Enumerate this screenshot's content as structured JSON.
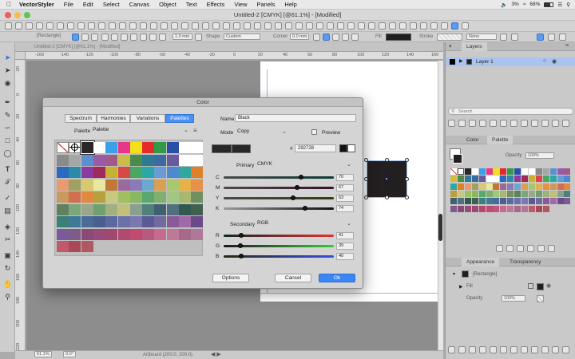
{
  "menubar": {
    "apple": "",
    "app": "VectorStyler",
    "items": [
      "File",
      "Edit",
      "Select",
      "Canvas",
      "Object",
      "Text",
      "Effects",
      "View",
      "Panels",
      "Help"
    ],
    "status": {
      "battery": "68%",
      "volume": "3%",
      "time": "Q"
    }
  },
  "window": {
    "title": "Untitled-2 [CMYK] [@61.1%] - [Modified]",
    "doc_tab": "Untitled-2 [CMYK] [@61.1%] - [Modified]"
  },
  "toolbar": {
    "object_type": "[Rectangle]",
    "stroke_width": "1.0 mm",
    "shape_label": "Shape",
    "shape_value": "Custom",
    "corner_label": "Corner",
    "corner_value": "0.0 mm",
    "fill_label": "Fill",
    "stroke_label": "Stroke",
    "stroke_value": "None"
  },
  "rulers": {
    "h_ticks": [
      "-160",
      "-140",
      "-120",
      "-100",
      "-80",
      "-60",
      "-40",
      "-20",
      "0",
      "20",
      "40",
      "60",
      "80",
      "100",
      "120",
      "140",
      "160"
    ],
    "v_ticks": [
      "-20",
      "0",
      "20",
      "40",
      "60",
      "80",
      "100",
      "120",
      "140",
      "160",
      "180",
      "200",
      "220"
    ]
  },
  "statusbar": {
    "zoom": "61.1%",
    "rotation": "0.0°",
    "artboard": "Artboard (200.0, 200.0)"
  },
  "panels": {
    "layers": {
      "title": "Layers",
      "layer_name": "Layer 1",
      "search_placeholder": "Search"
    },
    "color_tabs": [
      "Color",
      "Palette"
    ],
    "opacity_label": "Opacity",
    "opacity_value": "100%",
    "appearance": {
      "tabs": [
        "Appearance",
        "Transparency"
      ],
      "item": "[Rectangle]",
      "fill_row": "Fill",
      "opacity_label": "Opacity",
      "opacity_value": "100%"
    }
  },
  "dialog": {
    "title": "Color",
    "tabs": [
      "Spectrum",
      "Harmonies",
      "Variations",
      "Palettes"
    ],
    "active_tab": "Palettes",
    "palette_label": "Palette",
    "palette_value": "Palette",
    "name_label": "Name",
    "name_value": "Black",
    "mode_label": "Mode",
    "mode_value": "Copy",
    "preview_label": "Preview",
    "hex_label": "#",
    "hex_value": "292728",
    "primary_label": "Primary",
    "primary_value": "CMYK",
    "primary_channels": [
      {
        "label": "C",
        "value": "70",
        "fraction": 0.7
      },
      {
        "label": "M",
        "value": "67",
        "fraction": 0.67
      },
      {
        "label": "Y",
        "value": "63",
        "fraction": 0.63
      },
      {
        "label": "K",
        "value": "74",
        "fraction": 0.74
      }
    ],
    "secondary_label": "Secondary",
    "secondary_value": "RGB",
    "secondary_channels": [
      {
        "label": "R",
        "value": "41",
        "fraction": 0.161
      },
      {
        "label": "G",
        "value": "39",
        "fraction": 0.153
      },
      {
        "label": "B",
        "value": "40",
        "fraction": 0.157
      }
    ],
    "options_label": "Options",
    "cancel_label": "Cancel",
    "ok_label": "Ok",
    "current_color": "#292728",
    "swatches": [
      "none",
      "registration",
      "#292728",
      "#ffffff",
      "#3aa0e8",
      "#e8378a",
      "#f2e018",
      "#e42b2b",
      "#2f9a48",
      "#2a4fa8",
      "#ffffff",
      "#ffffff",
      "#8a8a8a",
      "#a6a6a6",
      "#5c8fd0",
      "#9a5aa8",
      "#a25a8a",
      "#cdbd48",
      "#4a8a4a",
      "#2f7a92",
      "#3a6aa0",
      "#6a5aa0",
      "#ffffff",
      "#ffffff",
      "#2a6ac0",
      "#2a8aa8",
      "#8a3aa0",
      "#a02a5a",
      "#c8b030",
      "#d84848",
      "#48a860",
      "#2aa8a8",
      "#6a9ad8",
      "#4a8ad0",
      "#30a8a0",
      "#e08028",
      "#e89a70",
      "#a0a060",
      "#d8c870",
      "#e8e8a0",
      "#c07838",
      "#9a6a9a",
      "#8a7ab8",
      "#6aa8d0",
      "#d8a050",
      "#a8c870",
      "#e8b048",
      "#e89048",
      "#c89a60",
      "#d07050",
      "#e08a40",
      "#b8a040",
      "#c8c880",
      "#a0c060",
      "#8ab860",
      "#5aa870",
      "#80b070",
      "#a0c880",
      "#a8b870",
      "#709060",
      "#608060",
      "#7aa878",
      "#98a888",
      "#70a070",
      "#a0b080",
      "#c0c078",
      "#88a090",
      "#50807a",
      "#406070",
      "#507080",
      "#305a50",
      "#406050",
      "#3a8078",
      "#407898",
      "#4a6a98",
      "#486090",
      "#5a6aa0",
      "#6a70a8",
      "#7a78b0",
      "#5a5a98",
      "#706aa0",
      "#8a5a98",
      "#a06aa8",
      "#6a4a88",
      "#7a5a98",
      "#805a88",
      "#8a4a78",
      "#9a4a78",
      "#a04870",
      "#b04a70",
      "#c04a70",
      "#b85a80",
      "#c86a90",
      "#c07898",
      "#a8688a",
      "#b07898",
      "#c05a68",
      "#a84858",
      "#b05860"
    ]
  },
  "object_color": "#231f20"
}
